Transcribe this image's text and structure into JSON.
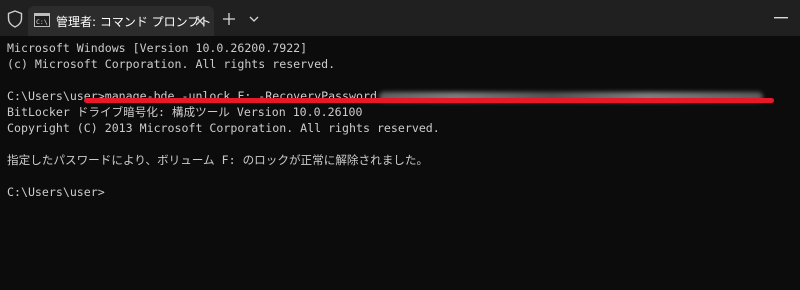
{
  "window": {
    "tab_title": "管理者: コマンド プロンプト",
    "icons": [
      "shield-icon",
      "cmd-icon",
      "close-icon",
      "plus-icon",
      "chevron-down-icon",
      "minimize-icon"
    ]
  },
  "console": {
    "lines": [
      "Microsoft Windows [Version 10.0.26200.7922]",
      "(c) Microsoft Corporation. All rights reserved.",
      "",
      "C:\\Users\\user>manage-bde -unlock F: -RecoveryPassword",
      "BitLocker ドライブ暗号化: 構成ツール Version 10.0.26100",
      "Copyright (C) 2013 Microsoft Corporation. All rights reserved.",
      "",
      "指定したパスワードにより、ボリューム F: のロックが正常に解除されました。",
      "",
      "C:\\Users\\user>"
    ],
    "highlight_color": "#e8182a"
  }
}
